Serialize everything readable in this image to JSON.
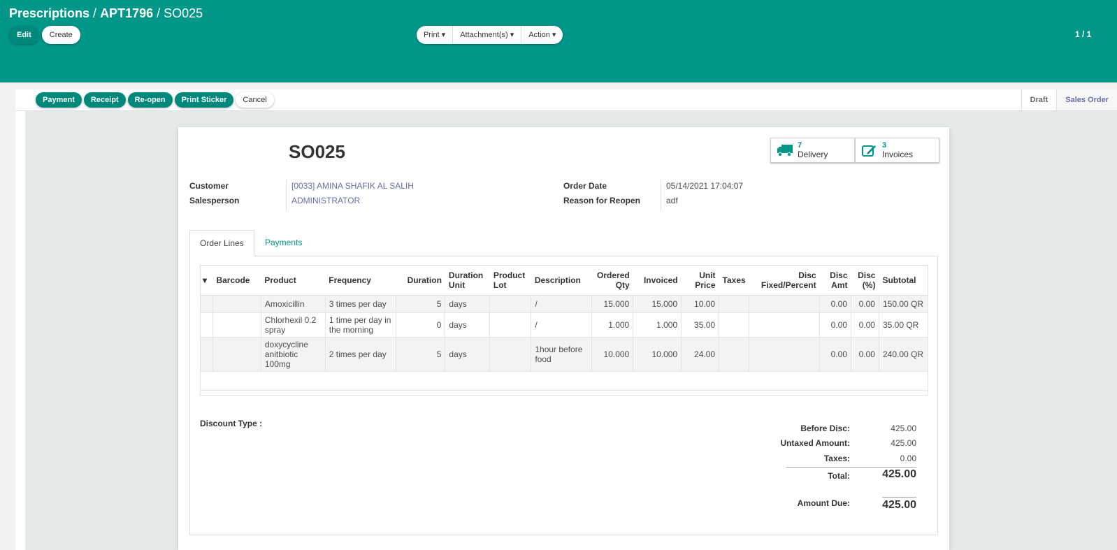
{
  "breadcrumb": {
    "root": "Prescriptions",
    "parent": "APT1796",
    "current": "SO025"
  },
  "control": {
    "edit": "Edit",
    "create": "Create",
    "print": "Print",
    "attachments": "Attachment(s)",
    "action": "Action",
    "pager": "1 / 1"
  },
  "status_buttons": [
    "Payment",
    "Receipt",
    "Re-open",
    "Print Sticker",
    "Cancel"
  ],
  "stages": [
    "Draft",
    "Sales Order"
  ],
  "record": {
    "name": "SO025",
    "smart": [
      {
        "count": "7",
        "label": "Delivery",
        "icon": "truck-icon"
      },
      {
        "count": "3",
        "label": "Invoices",
        "icon": "edit-icon"
      }
    ],
    "customer_label": "Customer",
    "customer": "[0033] AMINA SHAFIK AL SALIH",
    "salesperson_label": "Salesperson",
    "salesperson": "ADMINISTRATOR",
    "order_date_label": "Order Date",
    "order_date": "05/14/2021 17:04:07",
    "reason_label": "Reason for Reopen",
    "reason": "adf"
  },
  "tabs": [
    "Order Lines",
    "Payments"
  ],
  "table": {
    "headers": [
      "Barcode",
      "Product",
      "Frequency",
      "Duration",
      "Duration Unit",
      "Product Lot",
      "Description",
      "Ordered Qty",
      "Invoiced",
      "Unit Price",
      "Taxes",
      "Disc Fixed/Percent",
      "Disc Amt",
      "Disc (%)",
      "Subtotal"
    ],
    "rows": [
      [
        "",
        "Amoxicillin",
        "3 times per day",
        "5",
        "days",
        "",
        "/",
        "15.000",
        "15.000",
        "10.00",
        "",
        "",
        "0.00",
        "0.00",
        "150.00 QR"
      ],
      [
        "",
        "Chlorhexil 0.2 spray",
        "1 time per day in the morning",
        "0",
        "days",
        "",
        "/",
        "1.000",
        "1.000",
        "35.00",
        "",
        "",
        "0.00",
        "0.00",
        "35.00 QR"
      ],
      [
        "",
        "doxycycline anitbiotic 100mg",
        "2 times per day",
        "5",
        "days",
        "",
        "1hour before food",
        "10.000",
        "10.000",
        "24.00",
        "",
        "",
        "0.00",
        "0.00",
        "240.00 QR"
      ]
    ]
  },
  "discount_type_label": "Discount Type :",
  "totals": {
    "before_disc_label": "Before Disc:",
    "before_disc": "425.00",
    "untaxed_label": "Untaxed Amount:",
    "untaxed": "425.00",
    "taxes_label": "Taxes:",
    "taxes": "0.00",
    "total_label": "Total:",
    "total": "425.00",
    "due_label": "Amount Due:",
    "due": "425.00"
  }
}
